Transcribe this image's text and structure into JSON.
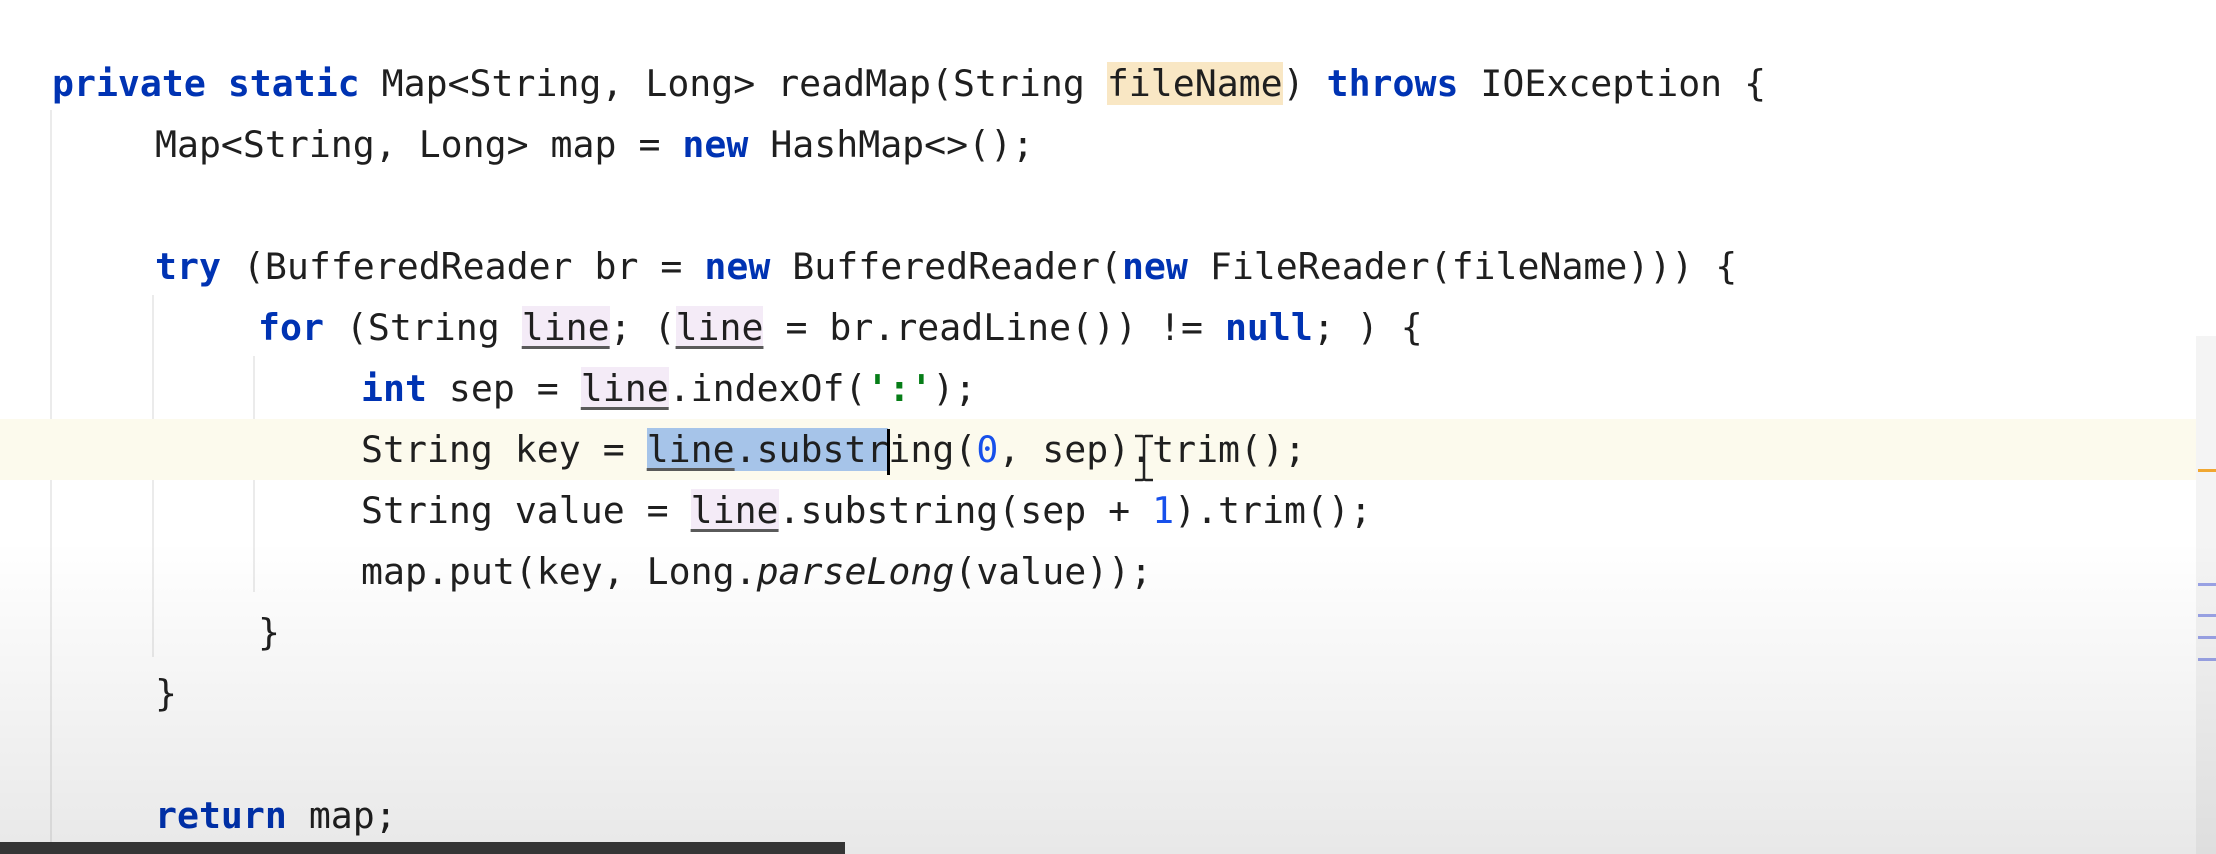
{
  "code": {
    "line1": {
      "kw_private": "private",
      "kw_static": "static",
      "sig_a": "Map<String, Long> readMap(String ",
      "param": "fileName",
      "sig_b": ") ",
      "kw_throws": "throws",
      "sig_c": " IOException {"
    },
    "line2": {
      "a": "Map<String, Long> map = ",
      "kw_new": "new",
      "b": " HashMap<>();"
    },
    "line4": {
      "kw_try": "try",
      "a": " (BufferedReader br = ",
      "kw_new1": "new",
      "b": " BufferedReader(",
      "kw_new2": "new",
      "c": " FileReader(fileName))) {"
    },
    "line5": {
      "kw_for": "for",
      "a": " (String ",
      "var1": "line",
      "b": "; (",
      "var2": "line",
      "c": " = br.readLine()) != ",
      "kw_null": "null",
      "d": "; ) {"
    },
    "line6": {
      "kw_int": "int",
      "a": " sep = ",
      "var": "line",
      "b": ".indexOf(",
      "str": "':'",
      "c": ");"
    },
    "line7": {
      "a": "String key = ",
      "sel_var": "line",
      "sel_rest": ".substr",
      "b": "ing(",
      "num": "0",
      "c": ", sep).trim();"
    },
    "line8": {
      "a": "String value = ",
      "var": "line",
      "b": ".substring(sep + ",
      "num": "1",
      "c": ").trim();"
    },
    "line9": {
      "a": "map.put(key, Long.",
      "it": "parseLong",
      "b": "(value));"
    },
    "line10": {
      "a": "}"
    },
    "line11": {
      "a": "}"
    },
    "line13": {
      "kw_return": "return",
      "a": " map;"
    }
  },
  "colors": {
    "keyword": "#0033b3",
    "number": "#1750eb",
    "string": "#067d17",
    "selection": "#a6c4e9",
    "current_line": "#fcfaed",
    "param_highlight": "#f9e7c4"
  },
  "icons": {
    "cursor": "ibeam-cursor-icon"
  }
}
